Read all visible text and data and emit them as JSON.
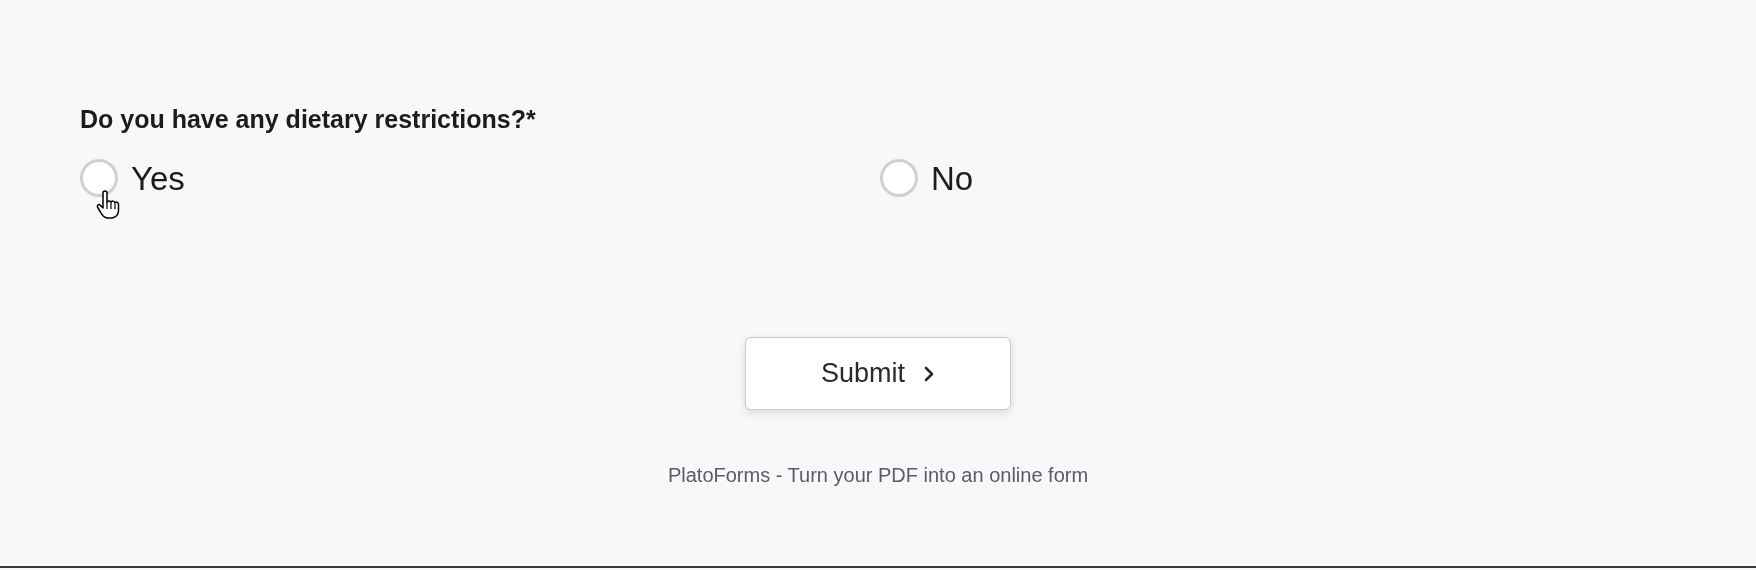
{
  "question": {
    "label": "Do you have any dietary restrictions?*"
  },
  "options": [
    {
      "label": "Yes",
      "selected": false
    },
    {
      "label": "No",
      "selected": false
    }
  ],
  "submit_button": {
    "label": "Submit"
  },
  "footer": "PlatoForms - Turn your PDF into an online form"
}
